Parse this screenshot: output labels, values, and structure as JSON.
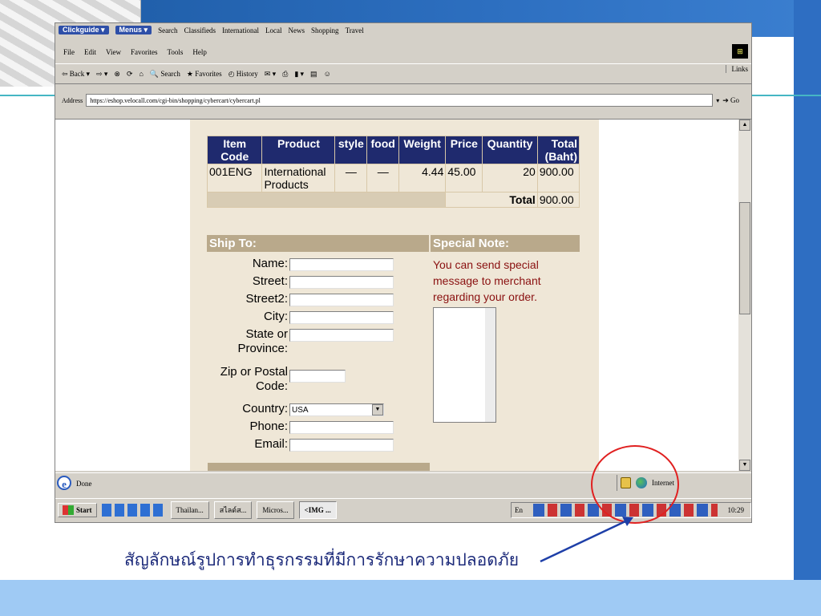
{
  "slide": {
    "caption": "สัญลักษณ์รูปการทำธุรกรรมที่มีการรักษาความปลอดภัย"
  },
  "browser": {
    "linkbar": {
      "clickguide": "Clickguide ▾",
      "menus": "Menus ▾",
      "items": [
        "Search",
        "Classifieds",
        "International",
        "Local",
        "News",
        "Shopping",
        "Travel"
      ]
    },
    "menu": [
      "File",
      "Edit",
      "View",
      "Favorites",
      "Tools",
      "Help"
    ],
    "toolbar": {
      "back": "Back",
      "search": "Search",
      "favorites": "Favorites",
      "history": "History",
      "links": "Links"
    },
    "address": {
      "label": "Address",
      "url": "https://eshop.velocall.com/cgi-bin/shopping/cybercart/cybercart.pl",
      "go": "Go"
    }
  },
  "cart": {
    "headers": {
      "item_code": "Item Code",
      "product": "Product",
      "style": "style",
      "food": "food",
      "weight": "Weight",
      "price": "Price",
      "quantity": "Quantity",
      "total": "Total (Baht)"
    },
    "rows": [
      {
        "item_code": "001ENG",
        "product": "International Products",
        "style": "—",
        "food": "—",
        "weight": "4.44",
        "price": "45.00",
        "quantity": "20",
        "total": "900.00"
      }
    ],
    "total_label": "Total",
    "total_value": "900.00"
  },
  "ship": {
    "title": "Ship To:",
    "fields": {
      "name": "Name:",
      "street": "Street:",
      "street2": "Street2:",
      "city": "City:",
      "state": "State or Province:",
      "zip": "Zip or Postal Code:",
      "country": "Country:",
      "phone": "Phone:",
      "email": "Email:"
    },
    "country_value": "USA"
  },
  "note": {
    "title": "Special Note:",
    "text": "You can send special message to merchant regarding your order."
  },
  "status": {
    "text": "Done",
    "zone": "Internet"
  },
  "taskbar": {
    "start": "Start",
    "tasks": [
      "Thailan...",
      "สไลด์ส...",
      "Micros...",
      "<IMG ..."
    ],
    "lang": "En",
    "clock": "10:29"
  },
  "colors": {
    "header_bg": "#1f2a6e",
    "bar_bg": "#b9a98b",
    "note_text": "#8a1010",
    "highlight_circle": "#e02020"
  }
}
